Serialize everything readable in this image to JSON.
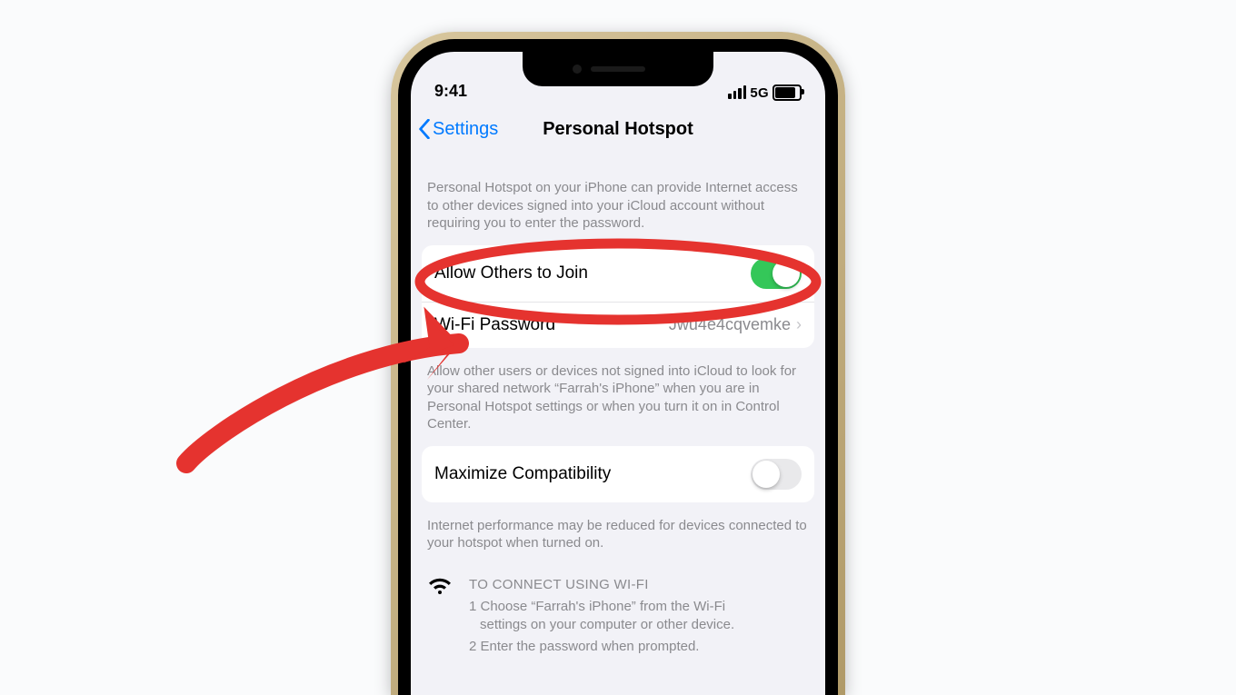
{
  "status": {
    "time": "9:41",
    "network_label": "5G"
  },
  "nav": {
    "back_label": "Settings",
    "title": "Personal Hotspot"
  },
  "intro_note": "Personal Hotspot on your iPhone can provide Internet access to other devices signed into your iCloud account without requiring you to enter the password.",
  "rows": {
    "allow_label": "Allow Others to Join",
    "password_label": "Wi-Fi Password",
    "password_value": "Jwu4e4cqvemke"
  },
  "allow_note": "Allow other users or devices not signed into iCloud to look for your shared network “Farrah's iPhone” when you are in Personal Hotspot settings or when you turn it on in Control Center.",
  "compat": {
    "label": "Maximize Compatibility",
    "note": "Internet performance may be reduced for devices connected to your hotspot when turned on."
  },
  "instructions": {
    "title": "TO CONNECT USING WI-FI",
    "step1_a": "1 Choose “Farrah's iPhone” from the Wi-Fi",
    "step1_b": "settings on your computer or other device.",
    "step2": "2 Enter the password when prompted."
  },
  "colors": {
    "ios_blue": "#007aff",
    "toggle_green": "#34c759",
    "annotation_red": "#e5332f"
  }
}
